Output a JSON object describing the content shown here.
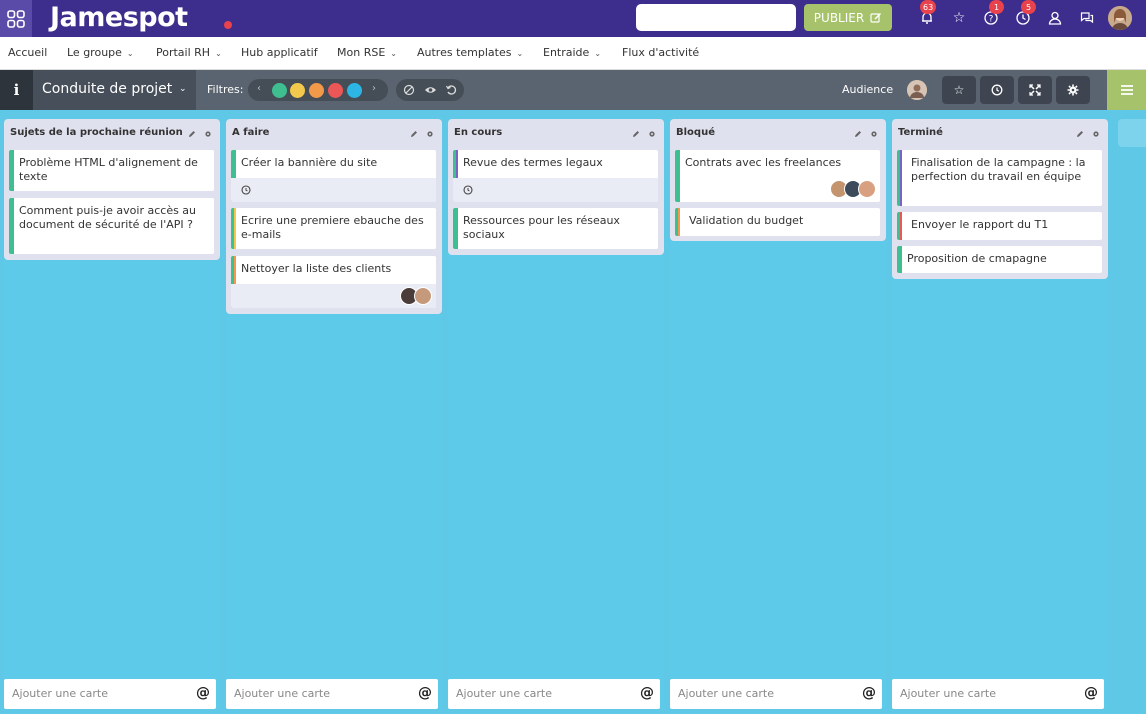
{
  "app": {
    "name": "Jamespot"
  },
  "topbar": {
    "publish_label": "PUBLIER",
    "notifications_badge": "63",
    "help_badge": "1",
    "history_badge": "5",
    "icons": [
      "bell-icon",
      "star-icon",
      "help-icon",
      "history-icon",
      "user-icon",
      "chat-icon"
    ]
  },
  "nav": {
    "items": [
      {
        "label": "Accueil"
      },
      {
        "label": "Le groupe"
      },
      {
        "label": "Portail RH"
      },
      {
        "label": "Hub applicatif"
      },
      {
        "label": "Mon RSE"
      },
      {
        "label": "Autres templates"
      },
      {
        "label": "Entraide"
      },
      {
        "label": "Flux d'activité"
      }
    ]
  },
  "board": {
    "info_label": "i",
    "title": "Conduite de projet",
    "filters_label": "Filtres:",
    "filter_colors": [
      "#3fbf8f",
      "#f2c94c",
      "#f2994a",
      "#eb5757",
      "#2db5e4"
    ],
    "audience_label": "Audience"
  },
  "columns": [
    {
      "title": "Sujets de la prochaine réunion",
      "add_label": "Ajouter une carte",
      "cards": [
        {
          "text": "Problème HTML d'alignement de texte"
        },
        {
          "text": "Comment puis-je avoir accès au document de sécurité de l'API ?"
        }
      ]
    },
    {
      "title": "A faire",
      "add_label": "Ajouter une carte",
      "cards": [
        {
          "text": "Créer la bannière du site"
        },
        {
          "text": "Ecrire une premiere ebauche des e-mails"
        },
        {
          "text": "Nettoyer la liste des clients"
        }
      ]
    },
    {
      "title": "En cours",
      "add_label": "Ajouter une carte",
      "cards": [
        {
          "text": "Revue des termes legaux"
        },
        {
          "text": "Ressources pour les réseaux sociaux"
        }
      ]
    },
    {
      "title": "Bloqué",
      "add_label": "Ajouter une carte",
      "cards": [
        {
          "text": "Contrats avec les freelances"
        },
        {
          "text": "Validation du budget"
        }
      ]
    },
    {
      "title": "Terminé",
      "add_label": "Ajouter une carte",
      "cards": [
        {
          "text": "Finalisation de la campagne : la perfection du travail en équipe"
        },
        {
          "text": "Envoyer le rapport du T1"
        },
        {
          "text": "Proposition de cmapagne"
        }
      ]
    }
  ],
  "colors": {
    "topbar": "#3d2d8c",
    "accent_green": "#a6c26a",
    "board_bg": "#5fc8e6",
    "label_green": "#3fbf8f",
    "label_purple": "#7b61c4",
    "label_yellow": "#f2c94c",
    "label_orange": "#f2994a",
    "label_red": "#eb5757"
  }
}
